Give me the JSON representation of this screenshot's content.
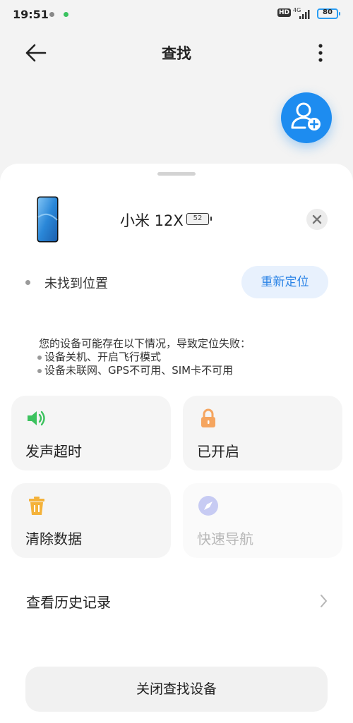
{
  "status_bar": {
    "time": "19:51",
    "hd": "HD",
    "network": "4G",
    "battery": "80"
  },
  "header": {
    "title": "查找",
    "back_icon": "arrow-left-icon",
    "more_icon": "more-vertical-icon"
  },
  "fab": {
    "icon": "add-person-icon",
    "color": "#1d8cf0"
  },
  "device": {
    "name": "小米 12X",
    "battery": "52"
  },
  "location": {
    "status": "未找到位置",
    "relocate_label": "重新定位"
  },
  "info": {
    "title": "您的设备可能存在以下情况，导致定位失败：",
    "items": [
      "设备关机、开启飞行模式",
      "设备未联网、GPS不可用、SIM卡不可用"
    ]
  },
  "actions": [
    {
      "label": "发声超时",
      "icon": "speaker-icon",
      "color": "#3cc25e",
      "enabled": true
    },
    {
      "label": "已开启",
      "icon": "lock-icon",
      "color": "#f5a55f",
      "enabled": true
    },
    {
      "label": "清除数据",
      "icon": "trash-icon",
      "color": "#f4b23a",
      "enabled": true
    },
    {
      "label": "快速导航",
      "icon": "compass-icon",
      "color": "#c7cbf3",
      "enabled": false
    }
  ],
  "history": {
    "label": "查看历史记录"
  },
  "footer": {
    "button_label": "关闭查找设备"
  }
}
